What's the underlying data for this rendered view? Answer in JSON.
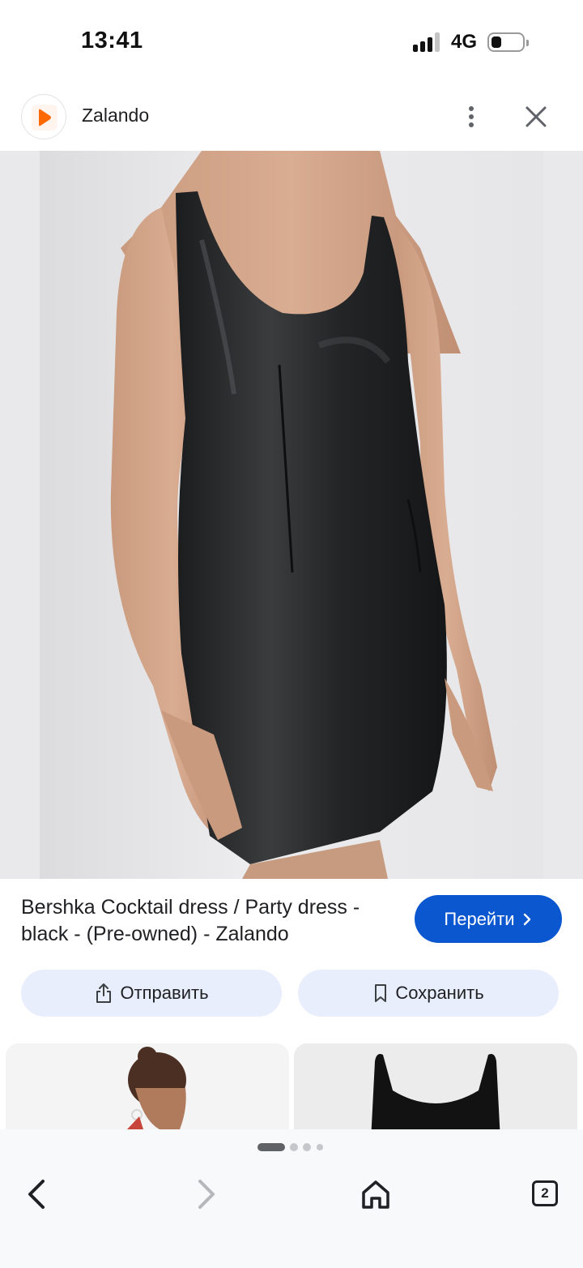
{
  "status_bar": {
    "time": "13:41",
    "network": "4G",
    "signal_bars": 3,
    "battery_level": 0.2
  },
  "header": {
    "site_name": "Zalando",
    "logo_color": "#ff6900"
  },
  "product_image": {
    "subject": "black sleeveless faux-leather mini dress"
  },
  "result": {
    "title": "Bershka Cocktail dress / Party dress - black - (Pre-owned) - Zalando",
    "visit_label": "Перейти"
  },
  "actions": {
    "share_label": "Отправить",
    "save_label": "Сохранить"
  },
  "colors": {
    "accent": "#0b57d0",
    "action_bg": "#e8eefb"
  },
  "pager": {
    "current": 1,
    "total": 4
  },
  "bottom_nav": {
    "tabs_count": "2"
  }
}
